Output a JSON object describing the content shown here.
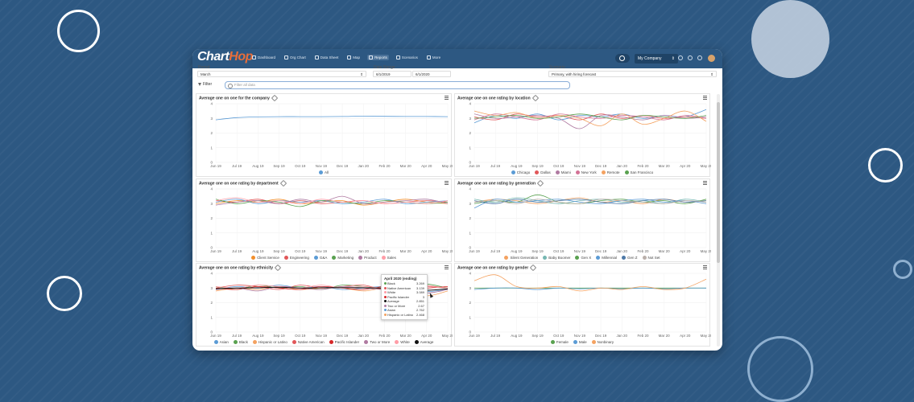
{
  "colors": {
    "background": "#2d5882",
    "topbar": "#2d5882",
    "accent": "#e86e3a"
  },
  "app": {
    "logo_chart": "Chart",
    "logo_hop": "Hop"
  },
  "nav": [
    {
      "label": "Dashboard",
      "icon": "dashboard-icon"
    },
    {
      "label": "Org Chart",
      "icon": "org-chart-icon"
    },
    {
      "label": "Data Sheet",
      "icon": "data-sheet-icon"
    },
    {
      "label": "Map",
      "icon": "map-icon"
    },
    {
      "label": "Reports",
      "icon": "reports-icon",
      "active": true
    },
    {
      "label": "Scenarios",
      "icon": "scenarios-icon"
    },
    {
      "label": "More",
      "icon": "more-icon"
    }
  ],
  "topbar": {
    "company": "My Company"
  },
  "controls": {
    "period_label": "Period",
    "period_value": "March",
    "date_range_label": "Date Range",
    "date_start": "6/1/2019",
    "date_end": "6/1/2020",
    "scenario_label": "Scenario",
    "scenario_value": "Primary, with hiring forecast",
    "filters_label": "Filter",
    "search_placeholder": "Filter all data"
  },
  "x_ticks": [
    "Jun 19",
    "Jul 19",
    "Aug 19",
    "Sep 19",
    "Oct 19",
    "Nov 19",
    "Dec 19",
    "Jan 20",
    "Feb 20",
    "Mar 20",
    "Apr 20",
    "May 20"
  ],
  "y_ticks": [
    "0",
    "1",
    "2",
    "3",
    "4"
  ],
  "panels": [
    {
      "title": "Average one on one for the company",
      "chart_data": {
        "type": "line",
        "ylim": [
          0,
          4
        ],
        "series": [
          {
            "name": "All",
            "color": "#5b9bd5",
            "values": [
              2.9,
              3.05,
              3.1,
              3.12,
              3.12,
              3.12,
              3.13,
              3.15,
              3.14,
              3.13,
              3.13,
              3.12
            ]
          }
        ]
      }
    },
    {
      "title": "Average one on one rating by location",
      "chart_data": {
        "type": "line",
        "ylim": [
          0,
          4
        ],
        "series": [
          {
            "name": "Chicago",
            "color": "#5b9bd5",
            "values": [
              2.7,
              3.2,
              3.0,
              3.3,
              2.9,
              3.2,
              3.1,
              3.3,
              3.0,
              3.2,
              3.1,
              3.6
            ]
          },
          {
            "name": "Dallas",
            "color": "#e15759",
            "values": [
              3.1,
              2.9,
              3.3,
              3.1,
              3.2,
              2.9,
              3.3,
              3.0,
              3.2,
              3.0,
              3.1,
              3.0
            ]
          },
          {
            "name": "Miami",
            "color": "#af7aa1",
            "values": [
              3.3,
              3.0,
              3.1,
              3.2,
              3.0,
              2.3,
              3.2,
              3.1,
              2.9,
              3.2,
              3.0,
              3.1
            ]
          },
          {
            "name": "New York",
            "color": "#d37295",
            "values": [
              2.9,
              3.3,
              3.1,
              2.9,
              3.3,
              3.1,
              3.0,
              3.2,
              3.1,
              2.9,
              3.2,
              3.0
            ]
          },
          {
            "name": "Remote",
            "color": "#f4a261",
            "values": [
              3.5,
              3.2,
              3.4,
              3.0,
              3.2,
              3.0,
              2.5,
              3.3,
              2.6,
              3.0,
              3.5,
              2.8
            ]
          },
          {
            "name": "San Francisco",
            "color": "#59a14f",
            "values": [
              3.0,
              3.1,
              3.2,
              3.0,
              3.1,
              3.3,
              3.1,
              2.9,
              3.2,
              3.1,
              3.0,
              3.2
            ]
          }
        ]
      }
    },
    {
      "title": "Average one on one rating by department",
      "chart_data": {
        "type": "line",
        "ylim": [
          0,
          4
        ],
        "series": [
          {
            "name": "Client Service",
            "color": "#f28e2b",
            "values": [
              3.0,
              3.2,
              3.1,
              3.3,
              3.0,
              3.1,
              3.2,
              2.9,
              3.1,
              3.3,
              3.1,
              3.0
            ]
          },
          {
            "name": "Engineering",
            "color": "#e15759",
            "values": [
              3.2,
              3.1,
              3.3,
              3.0,
              3.2,
              3.0,
              3.1,
              3.2,
              3.0,
              3.1,
              3.2,
              3.1
            ]
          },
          {
            "name": "G&A",
            "color": "#5b9bd5",
            "values": [
              3.1,
              3.3,
              3.0,
              3.2,
              3.1,
              3.2,
              3.0,
              3.1,
              3.3,
              3.0,
              3.1,
              3.2
            ]
          },
          {
            "name": "Marketing",
            "color": "#59a14f",
            "values": [
              3.3,
              3.0,
              3.2,
              3.1,
              2.8,
              3.2,
              3.1,
              3.0,
              3.2,
              3.1,
              3.0,
              3.1
            ]
          },
          {
            "name": "Product",
            "color": "#af7aa1",
            "values": [
              2.9,
              3.1,
              3.2,
              3.0,
              3.3,
              3.1,
              3.5,
              3.0,
              3.1,
              3.2,
              3.3,
              3.0
            ]
          },
          {
            "name": "Sales",
            "color": "#ff9da7",
            "values": [
              3.2,
              3.4,
              3.1,
              3.2,
              3.0,
              3.3,
              3.1,
              3.2,
              3.0,
              3.1,
              3.0,
              3.2
            ]
          }
        ]
      }
    },
    {
      "title": "Average one on one rating by generation",
      "chart_data": {
        "type": "line",
        "ylim": [
          0,
          4
        ],
        "series": [
          {
            "name": "Silent Generation",
            "color": "#f4a261",
            "values": [
              3.1,
              3.3,
              3.2,
              3.0,
              3.2,
              3.4,
              3.1,
              3.2,
              3.0,
              3.3,
              3.1,
              3.2
            ]
          },
          {
            "name": "Baby Boomer",
            "color": "#76b7b2",
            "values": [
              3.3,
              3.1,
              3.4,
              3.2,
              3.0,
              3.2,
              3.3,
              3.1,
              3.2,
              3.0,
              3.3,
              3.1
            ]
          },
          {
            "name": "Gen X",
            "color": "#59a14f",
            "values": [
              3.0,
              3.2,
              3.1,
              3.6,
              3.1,
              3.0,
              3.2,
              3.3,
              3.1,
              3.2,
              3.0,
              3.3
            ]
          },
          {
            "name": "Millennial",
            "color": "#5b9bd5",
            "values": [
              2.7,
              3.3,
              3.1,
              3.2,
              3.3,
              3.1,
              3.0,
              3.2,
              3.3,
              3.1,
              3.2,
              3.0
            ]
          },
          {
            "name": "Gen Z",
            "color": "#4e79a7",
            "values": [
              3.2,
              3.0,
              3.3,
              3.1,
              3.2,
              3.3,
              3.1,
              3.0,
              3.2,
              3.3,
              3.1,
              3.2
            ]
          },
          {
            "name": "Not Set",
            "color": "#bab0ab",
            "values": [
              3.1,
              3.2,
              3.0,
              3.3,
              3.1,
              3.0,
              3.3,
              3.2,
              3.1,
              3.0,
              3.2,
              3.1
            ]
          }
        ]
      }
    },
    {
      "title": "Average one on one rating by ethnicity",
      "chart_data": {
        "type": "line",
        "ylim": [
          0,
          4
        ],
        "series": [
          {
            "name": "Asian",
            "color": "#5b9bd5",
            "values": [
              2.9,
              3.1,
              3.0,
              3.2,
              3.0,
              3.1,
              2.9,
              3.0,
              3.1,
              3.0,
              2.76,
              2.9
            ]
          },
          {
            "name": "Black",
            "color": "#59a14f",
            "values": [
              3.1,
              2.9,
              3.2,
              3.0,
              3.1,
              2.9,
              3.2,
              3.1,
              3.0,
              3.2,
              3.27,
              3.0
            ]
          },
          {
            "name": "Hispanic or Latino",
            "color": "#f4a261",
            "values": [
              2.8,
              3.0,
              2.9,
              3.1,
              2.9,
              3.0,
              3.0,
              2.8,
              3.0,
              2.9,
              2.47,
              2.8
            ]
          },
          {
            "name": "Native American",
            "color": "#e15759",
            "values": [
              3.0,
              3.2,
              3.1,
              2.9,
              3.2,
              3.0,
              3.1,
              3.2,
              2.9,
              3.1,
              3.14,
              3.0
            ]
          },
          {
            "name": "Pacific Islander",
            "color": "#d62728",
            "values": [
              3.0,
              2.9,
              3.1,
              3.0,
              2.9,
              3.1,
              3.0,
              2.9,
              3.1,
              3.0,
              3.0,
              3.1
            ]
          },
          {
            "name": "Two or More",
            "color": "#af7aa1",
            "values": [
              2.9,
              3.0,
              2.8,
              3.1,
              3.0,
              2.9,
              3.1,
              3.0,
              2.9,
              3.0,
              2.67,
              2.9
            ]
          },
          {
            "name": "White",
            "color": "#ff9da7",
            "values": [
              3.1,
              3.0,
              3.2,
              3.1,
              3.0,
              3.2,
              3.0,
              3.1,
              3.0,
              3.1,
              3.09,
              3.0
            ]
          },
          {
            "name": "Average",
            "color": "#111111",
            "values": [
              2.95,
              3.0,
              3.02,
              3.05,
              3.0,
              3.02,
              3.03,
              3.02,
              3.0,
              3.02,
              2.85,
              2.95
            ]
          }
        ]
      }
    },
    {
      "title": "Average one on one rating by gender",
      "chart_data": {
        "type": "line",
        "ylim": [
          0,
          4
        ],
        "series": [
          {
            "name": "Female",
            "color": "#59a14f",
            "values": [
              3.0,
              3.0,
              3.0,
              3.0,
              3.0,
              3.0,
              3.0,
              3.0,
              3.0,
              3.0,
              3.0,
              3.0
            ]
          },
          {
            "name": "Male",
            "color": "#5b9bd5",
            "values": [
              2.9,
              3.0,
              3.0,
              2.9,
              3.0,
              2.95,
              3.0,
              2.95,
              3.0,
              2.95,
              3.0,
              3.0
            ]
          },
          {
            "name": "Nonbinary",
            "color": "#f4a261",
            "values": [
              3.5,
              3.9,
              3.1,
              3.0,
              3.1,
              2.8,
              3.0,
              2.9,
              3.1,
              2.9,
              3.0,
              3.6
            ]
          }
        ]
      }
    }
  ],
  "tooltip": {
    "title": "April 2020 (ending)",
    "rows": [
      {
        "name": "Black",
        "value": "3.269",
        "color": "#59a14f"
      },
      {
        "name": "Native American",
        "value": "3.139",
        "color": "#e15759"
      },
      {
        "name": "White",
        "value": "3.089",
        "color": "#ff9da7"
      },
      {
        "name": "Pacific Islander",
        "value": "3",
        "color": "#d62728"
      },
      {
        "name": "Average",
        "value": "2.851",
        "color": "#111111"
      },
      {
        "name": "Two or More",
        "value": "2.67",
        "color": "#af7aa1"
      },
      {
        "name": "Asian",
        "value": "2.762",
        "color": "#5b9bd5"
      },
      {
        "name": "Hispanic or Latino",
        "value": "2.468",
        "color": "#f4a261"
      }
    ]
  }
}
